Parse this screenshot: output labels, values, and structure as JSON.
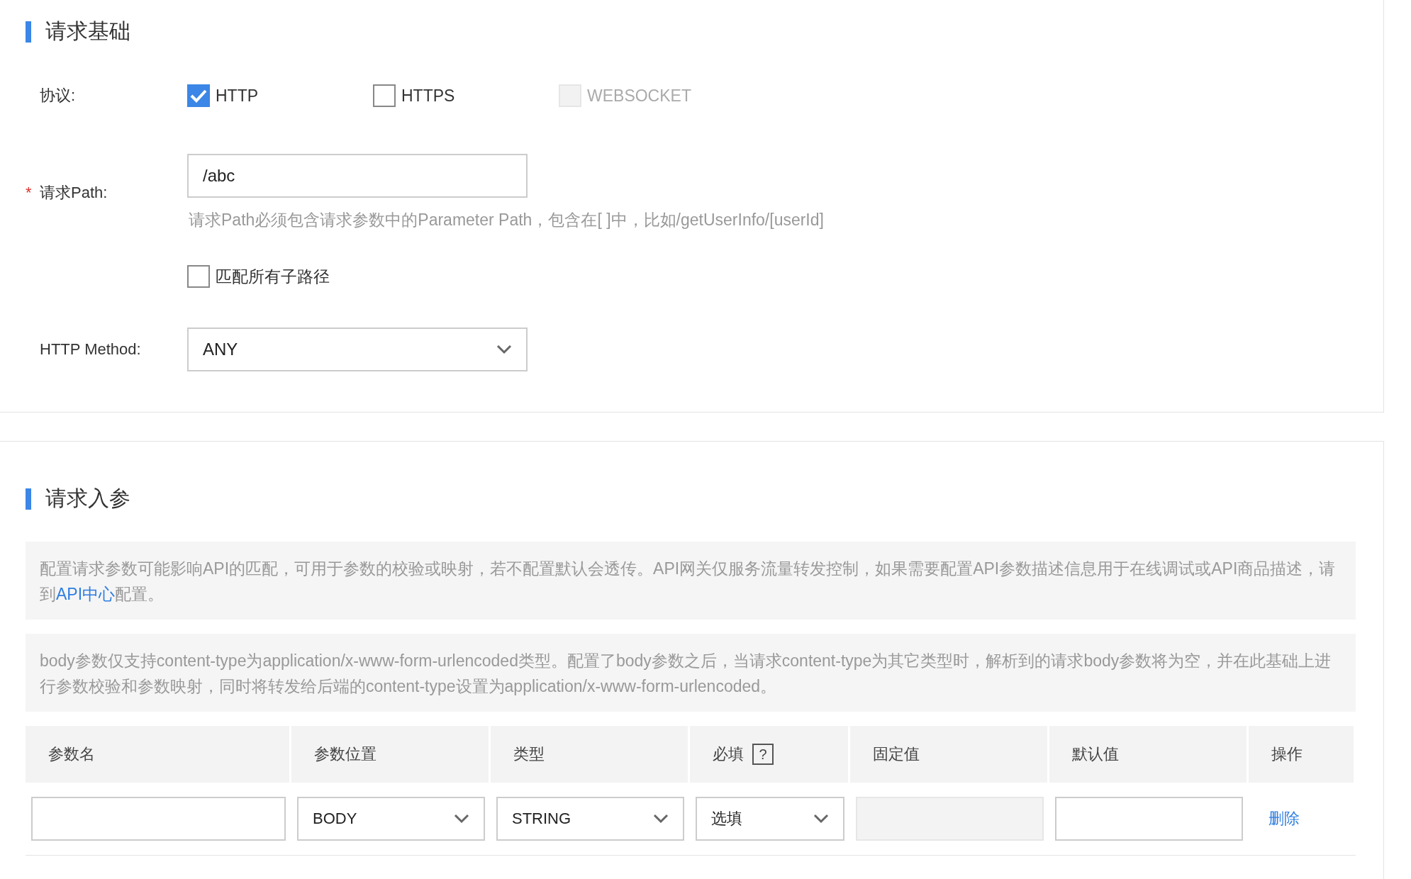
{
  "basic": {
    "title": "请求基础",
    "protocol": {
      "label": "协议:",
      "options": [
        {
          "label": "HTTP",
          "checked": true,
          "disabled": false
        },
        {
          "label": "HTTPS",
          "checked": false,
          "disabled": false
        },
        {
          "label": "WEBSOCKET",
          "checked": false,
          "disabled": true
        }
      ]
    },
    "path": {
      "label": "请求Path:",
      "required_mark": "*",
      "value": "/abc",
      "hint": "请求Path必须包含请求参数中的Parameter Path，包含在[ ]中，比如/getUserInfo/[userId]"
    },
    "match_subpaths": {
      "label": "匹配所有子路径",
      "checked": false
    },
    "method": {
      "label": "HTTP Method:",
      "value": "ANY"
    }
  },
  "params": {
    "title": "请求入参",
    "notices": [
      {
        "before": "配置请求参数可能影响API的匹配，可用于参数的校验或映射，若不配置默认会透传。API网关仅服务流量转发控制，如果需要配置API参数描述信息用于在线调试或API商品描述，请到",
        "link": "API中心",
        "after": "配置。"
      },
      {
        "before": "body参数仅支持content-type为application/x-www-form-urlencoded类型。配置了body参数之后，当请求content-type为其它类型时，解析到的请求body参数将为空，并在此基础上进行参数校验和参数映射，同时将转发给后端的content-type设置为application/x-www-form-urlencoded。"
      }
    ],
    "table": {
      "columns": [
        {
          "label": "参数名"
        },
        {
          "label": "参数位置"
        },
        {
          "label": "类型"
        },
        {
          "label": "必填",
          "help": "?"
        },
        {
          "label": "固定值"
        },
        {
          "label": "默认值"
        },
        {
          "label": "操作"
        }
      ],
      "rows": [
        {
          "cells": [
            {
              "kind": "input",
              "disabled": false
            },
            {
              "kind": "select",
              "value": "BODY"
            },
            {
              "kind": "select",
              "value": "STRING"
            },
            {
              "kind": "select",
              "value": "选填"
            },
            {
              "kind": "input",
              "disabled": true
            },
            {
              "kind": "input",
              "disabled": false
            },
            {
              "kind": "link",
              "text": "删除"
            }
          ]
        }
      ]
    }
  }
}
